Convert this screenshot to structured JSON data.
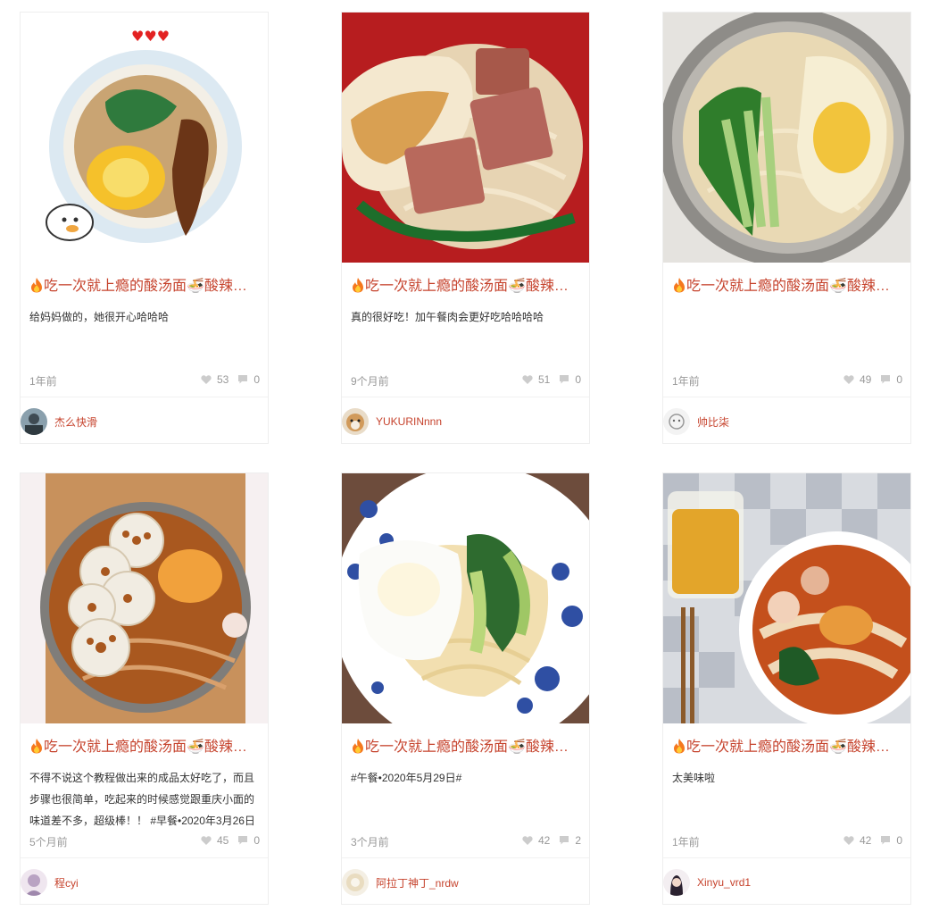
{
  "cards": [
    {
      "title": "吃一次就上瘾的酸汤面🍜酸辣…",
      "desc": "给妈妈做的，她很开心哈哈哈",
      "time": "1年前",
      "likes": "53",
      "comments": "0",
      "author": "杰么快滑",
      "photo": "bowl-with-egg-duck-leg"
    },
    {
      "title": "吃一次就上瘾的酸汤面🍜酸辣…",
      "desc": "真的很好吃！加午餐肉会更好吃哈哈哈哈",
      "time": "9个月前",
      "likes": "51",
      "comments": "0",
      "author": "YUKURINnnn",
      "photo": "red-bowl-with-luncheon-meat"
    },
    {
      "title": "吃一次就上瘾的酸汤面🍜酸辣…",
      "desc": "",
      "time": "1年前",
      "likes": "49",
      "comments": "0",
      "author": "帅比柒",
      "photo": "steel-bowl-with-greens"
    },
    {
      "title": "吃一次就上瘾的酸汤面🍜酸辣…",
      "desc": "不得不说这个教程做出来的成品太好吃了，而且步骤也很简单，吃起来的时候感觉跟重庆小面的味道差不多，超级棒！！ #早餐•2020年3月26日",
      "time": "5个月前",
      "likes": "45",
      "comments": "0",
      "author": "程cyi",
      "photo": "bowl-with-lotus-root"
    },
    {
      "title": "吃一次就上瘾的酸汤面🍜酸辣…",
      "desc": "#午餐•2020年5月29日#",
      "time": "3个月前",
      "likes": "42",
      "comments": "2",
      "author": "阿拉丁神丁_nrdw",
      "photo": "blue-white-plate-noodles"
    },
    {
      "title": "吃一次就上瘾的酸汤面🍜酸辣…",
      "desc": "太美味啦",
      "time": "1年前",
      "likes": "42",
      "comments": "0",
      "author": "Xinyu_vrd1",
      "photo": "bowl-with-juice-glass"
    }
  ],
  "icons": {
    "title_emoji": "fire-icon",
    "like": "heart-icon",
    "comment": "comment-icon"
  },
  "colors": {
    "title": "#c6432d",
    "author": "#c6432d",
    "meta": "#999999"
  }
}
